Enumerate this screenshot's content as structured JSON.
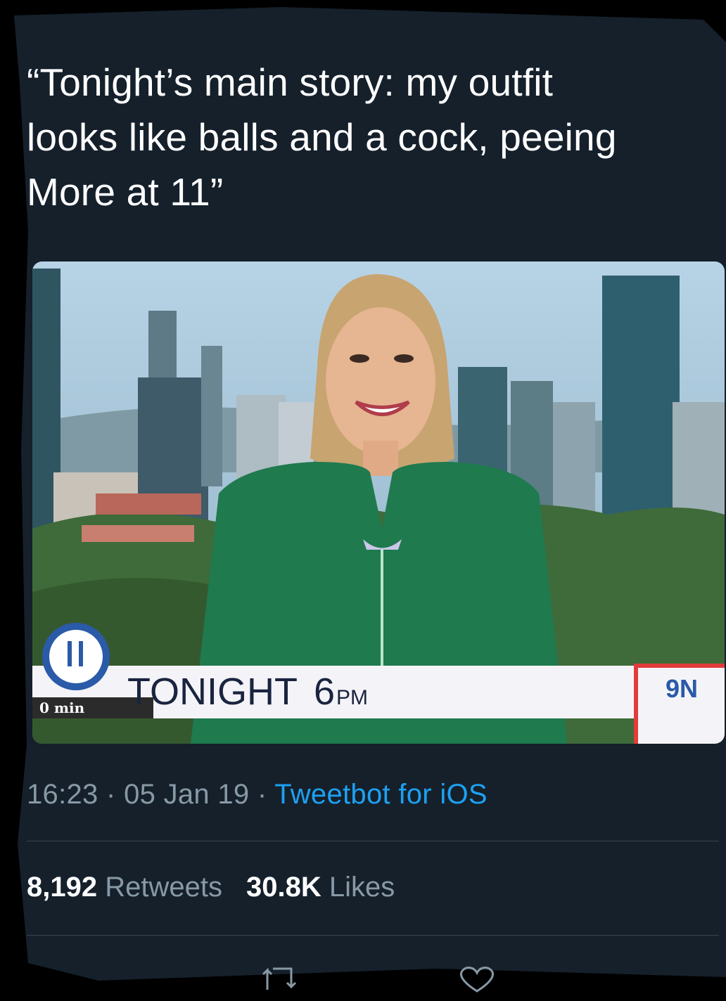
{
  "tweet": {
    "text": "“Tonight’s main story: my outfit\nlooks like balls and a cock, peeing\nMore at 11”"
  },
  "media": {
    "caption": "TONIGHT",
    "time_big": "6",
    "time_small": "PM",
    "channel_logo": "9N",
    "badge_sub": "0 min",
    "colors": {
      "dress": "#1f7a4e",
      "banner": "#f4f4f8",
      "accent": "#e23b3b",
      "sky": "#9cc0d6"
    }
  },
  "meta": {
    "time": "16:23",
    "sep1": " · ",
    "date": "05 Jan 19",
    "sep2": " · ",
    "source": "Tweetbot for iOS"
  },
  "stats": {
    "retweets_count": "8,192",
    "retweets_label": "Retweets",
    "likes_count": "30.8K",
    "likes_label": "Likes"
  },
  "actions": [
    {
      "icon": "retweet-icon"
    },
    {
      "icon": "heart-icon"
    }
  ]
}
